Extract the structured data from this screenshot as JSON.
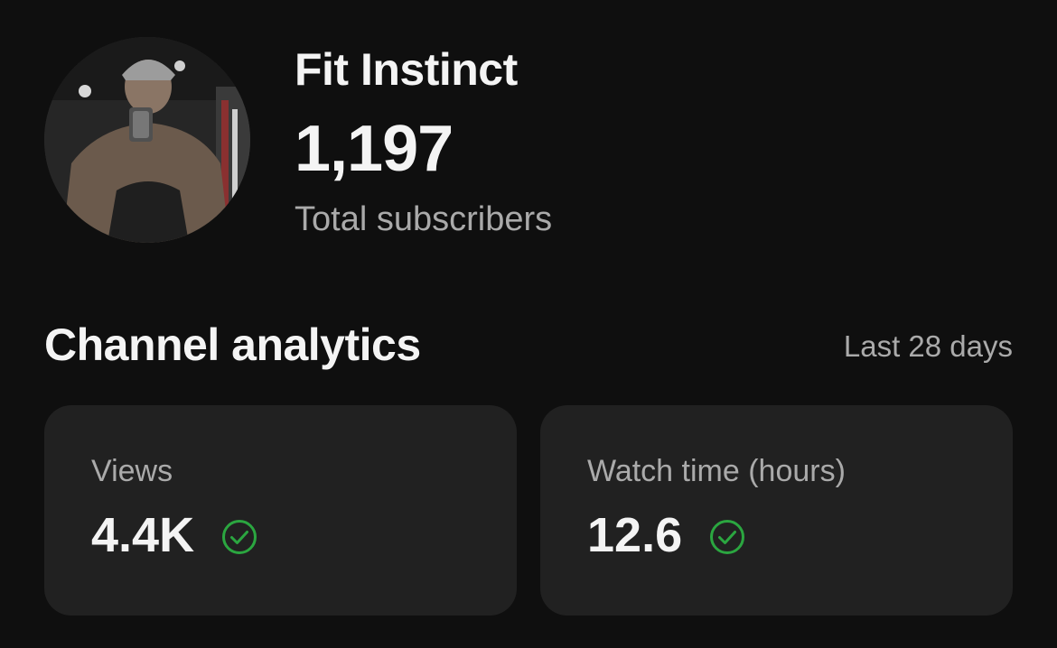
{
  "channel": {
    "name": "Fit Instinct",
    "subscriber_count": "1,197",
    "subscriber_label": "Total subscribers",
    "avatar_icon": "channel-avatar-photo"
  },
  "analytics": {
    "title": "Channel analytics",
    "period": "Last 28 days",
    "cards": [
      {
        "label": "Views",
        "value": "4.4K",
        "status_icon": "check-circle-icon"
      },
      {
        "label": "Watch time (hours)",
        "value": "12.6",
        "status_icon": "check-circle-icon"
      }
    ]
  },
  "colors": {
    "background": "#0f0f0f",
    "card": "#212121",
    "text_primary": "#f1f1f1",
    "text_secondary": "#aaaaaa",
    "check_green": "#2ba640"
  }
}
